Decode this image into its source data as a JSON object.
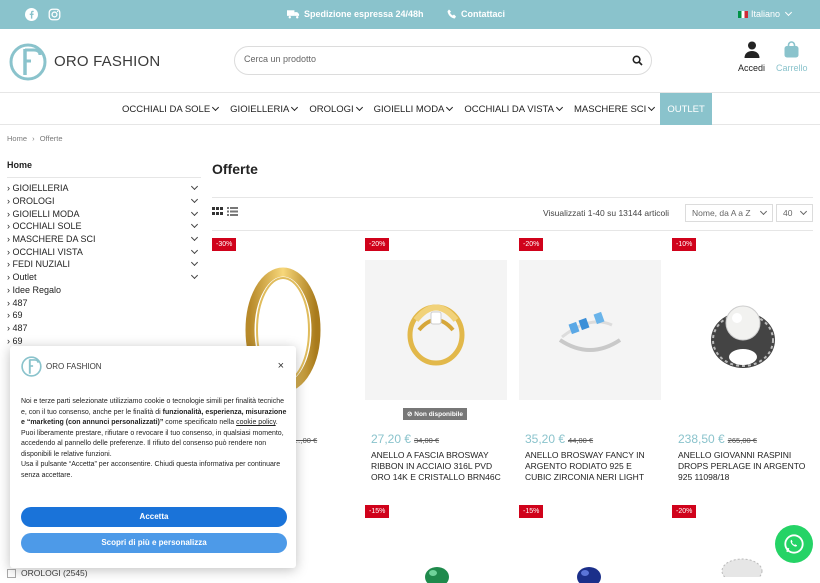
{
  "topbar": {
    "shipping": "Spedizione espressa 24/48h",
    "contact": "Contattaci",
    "language": "Italiano",
    "social": [
      "facebook-icon",
      "instagram-icon"
    ]
  },
  "header": {
    "logo": "ORO FASHION",
    "search_placeholder": "Cerca un prodotto",
    "account_label": "Accedi",
    "cart_label": "Carrello"
  },
  "nav": {
    "items": [
      "OCCHIALI DA SOLE",
      "GIOIELLERIA",
      "OROLOGI",
      "GIOIELLI MODA",
      "OCCHIALI DA VISTA",
      "MASCHERE SCI"
    ],
    "outlet": "OUTLET"
  },
  "breadcrumb": {
    "home": "Home",
    "sep": "›",
    "current": "Offerte"
  },
  "sidebar": {
    "home": "Home",
    "items": [
      {
        "label": "GIOIELLERIA",
        "expandable": true
      },
      {
        "label": "OROLOGI",
        "expandable": true
      },
      {
        "label": "GIOIELLI MODA",
        "expandable": true
      },
      {
        "label": "OCCHIALI SOLE",
        "expandable": true
      },
      {
        "label": "MASCHERE DA SCI",
        "expandable": true
      },
      {
        "label": "OCCHIALI VISTA",
        "expandable": true
      },
      {
        "label": "FEDI NUZIALI",
        "expandable": true
      },
      {
        "label": "Outlet",
        "expandable": true
      },
      {
        "label": "Idee Regalo",
        "expandable": false
      },
      {
        "label": "487",
        "expandable": false
      },
      {
        "label": "69",
        "expandable": false
      },
      {
        "label": "487",
        "expandable": false
      },
      {
        "label": "69",
        "expandable": false
      }
    ],
    "filter_bottom": "OROLOGI (2545)"
  },
  "main": {
    "title": "Offerte",
    "count": "Visualizzati 1-40 su 13144 articoli",
    "sort": "Nome, da A a Z",
    "per_page": "40"
  },
  "products": [
    {
      "discount": "-30%",
      "price": "",
      "old": "…,00 €",
      "name": ""
    },
    {
      "discount": "-20%",
      "price": "27,20 €",
      "old": "34,00 €",
      "name": "ANELLO A FASCIA BROSWAY RIBBON IN ACCIAIO 316L PVD ORO 14K E CRISTALLO BRN46C MISURA 16",
      "unavailable": "Non disponibile"
    },
    {
      "discount": "-20%",
      "price": "35,20 €",
      "old": "44,00 €",
      "name": "ANELLO BROSWAY FANCY IN ARGENTO RODIATO 925 E CUBIC ZIRCONIA NERI LIGHT SAPPHIRE"
    },
    {
      "discount": "-10%",
      "price": "238,50 €",
      "old": "265,00 €",
      "name": "ANELLO GIOVANNI RASPINI DROPS PERLAGE IN ARGENTO 925 11098/18"
    }
  ],
  "products_row2": [
    "-15%",
    "-15%",
    "-20%"
  ],
  "cookie": {
    "logo": "ORO FASHION",
    "text1": "Noi e terze parti selezionate utilizziamo cookie o tecnologie simili per finalità tecniche e, con il tuo consenso, anche per le finalità di ",
    "text1_bold": "funzionalità, esperienza, misurazione e “marketing (con annunci personalizzati)”",
    "text1_end": " come specificato nella ",
    "policy_link": "cookie policy",
    "text2": "Puoi liberamente prestare, rifiutare o revocare il tuo consenso, in qualsiasi momento, accedendo al pannello delle preferenze. Il rifiuto del consenso può rendere non disponibili le relative funzioni.",
    "text3": "Usa il pulsante “Accetta” per acconsentire. Chiudi questa informativa per continuare senza accettare.",
    "accept": "Accetta",
    "more": "Scopri di più e personalizza",
    "close": "×"
  },
  "colors": {
    "accent": "#8ac3cc",
    "badge": "#d0021b",
    "accept": "#1a73d9",
    "whatsapp": "#25d366"
  }
}
